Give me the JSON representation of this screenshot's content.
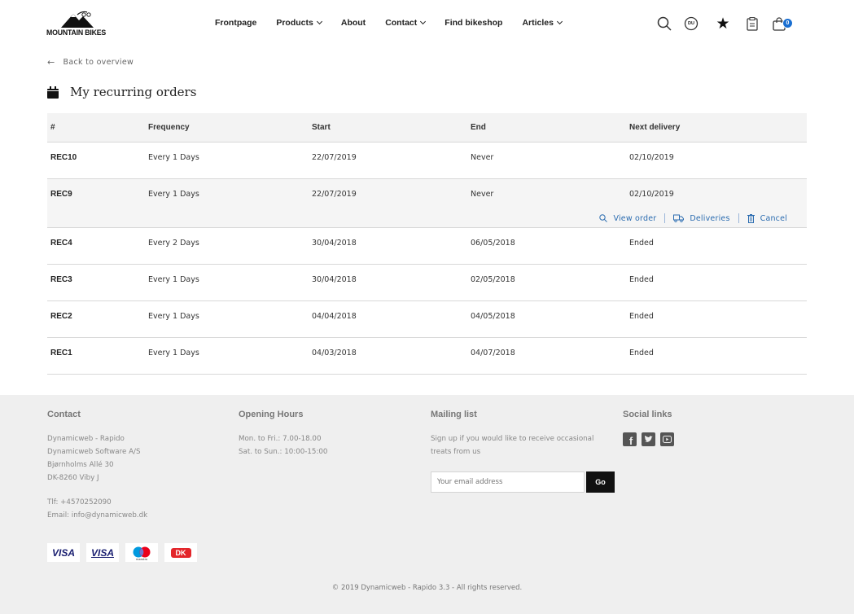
{
  "brand": {
    "logo_text": "MOUNTAIN BIKES"
  },
  "nav": {
    "items": [
      {
        "label": "Frontpage",
        "dropdown": false
      },
      {
        "label": "Products",
        "dropdown": true
      },
      {
        "label": "About",
        "dropdown": false
      },
      {
        "label": "Contact",
        "dropdown": true
      },
      {
        "label": "Find bikeshop",
        "dropdown": false
      },
      {
        "label": "Articles",
        "dropdown": true
      }
    ]
  },
  "tools": {
    "user_initials": "DU",
    "cart_count": "0"
  },
  "back_link": "Back to overview",
  "page_title": "My recurring orders",
  "table": {
    "headers": [
      "#",
      "Frequency",
      "Start",
      "End",
      "Next delivery"
    ],
    "rows": [
      {
        "id": "REC10",
        "frequency": "Every 1 Days",
        "start": "22/07/2019",
        "end": "Never",
        "next": "02/10/2019"
      },
      {
        "id": "REC9",
        "frequency": "Every 1 Days",
        "start": "22/07/2019",
        "end": "Never",
        "next": "02/10/2019"
      },
      {
        "id": "REC4",
        "frequency": "Every 2 Days",
        "start": "30/04/2018",
        "end": "06/05/2018",
        "next": "Ended"
      },
      {
        "id": "REC3",
        "frequency": "Every 1 Days",
        "start": "30/04/2018",
        "end": "02/05/2018",
        "next": "Ended"
      },
      {
        "id": "REC2",
        "frequency": "Every 1 Days",
        "start": "04/04/2018",
        "end": "04/05/2018",
        "next": "Ended"
      },
      {
        "id": "REC1",
        "frequency": "Every 1 Days",
        "start": "04/03/2018",
        "end": "04/07/2018",
        "next": "Ended"
      }
    ],
    "row_actions": {
      "view": "View order",
      "deliveries": "Deliveries",
      "cancel": "Cancel"
    }
  },
  "footer": {
    "contact": {
      "heading": "Contact",
      "lines": [
        "Dynamicweb - Rapido",
        "Dynamicweb Software A/S",
        "Bjørnholms Allé 30",
        "DK-8260 Viby J"
      ],
      "phone": "Tlf: +4570252090",
      "email": "Email: info@dynamicweb.dk"
    },
    "hours": {
      "heading": "Opening Hours",
      "lines": [
        "Mon. to Fri.: 7.00-18.00",
        "Sat. to Sun.: 10:00-15:00"
      ]
    },
    "mailing": {
      "heading": "Mailing list",
      "lines": [
        "Sign up if you would like to receive occasional",
        "treats from us"
      ],
      "placeholder": "Your email address",
      "button": "Go"
    },
    "social": {
      "heading": "Social links"
    },
    "cards": [
      "VISA",
      "VISA",
      "maestro",
      "DK"
    ],
    "copyright": "© 2019 Dynamicweb - Rapido 3.3 - All rights reserved."
  },
  "colors": {
    "accent": "#2b6cb0",
    "badge": "#1a6fd1",
    "footer_bg": "#efefef"
  }
}
